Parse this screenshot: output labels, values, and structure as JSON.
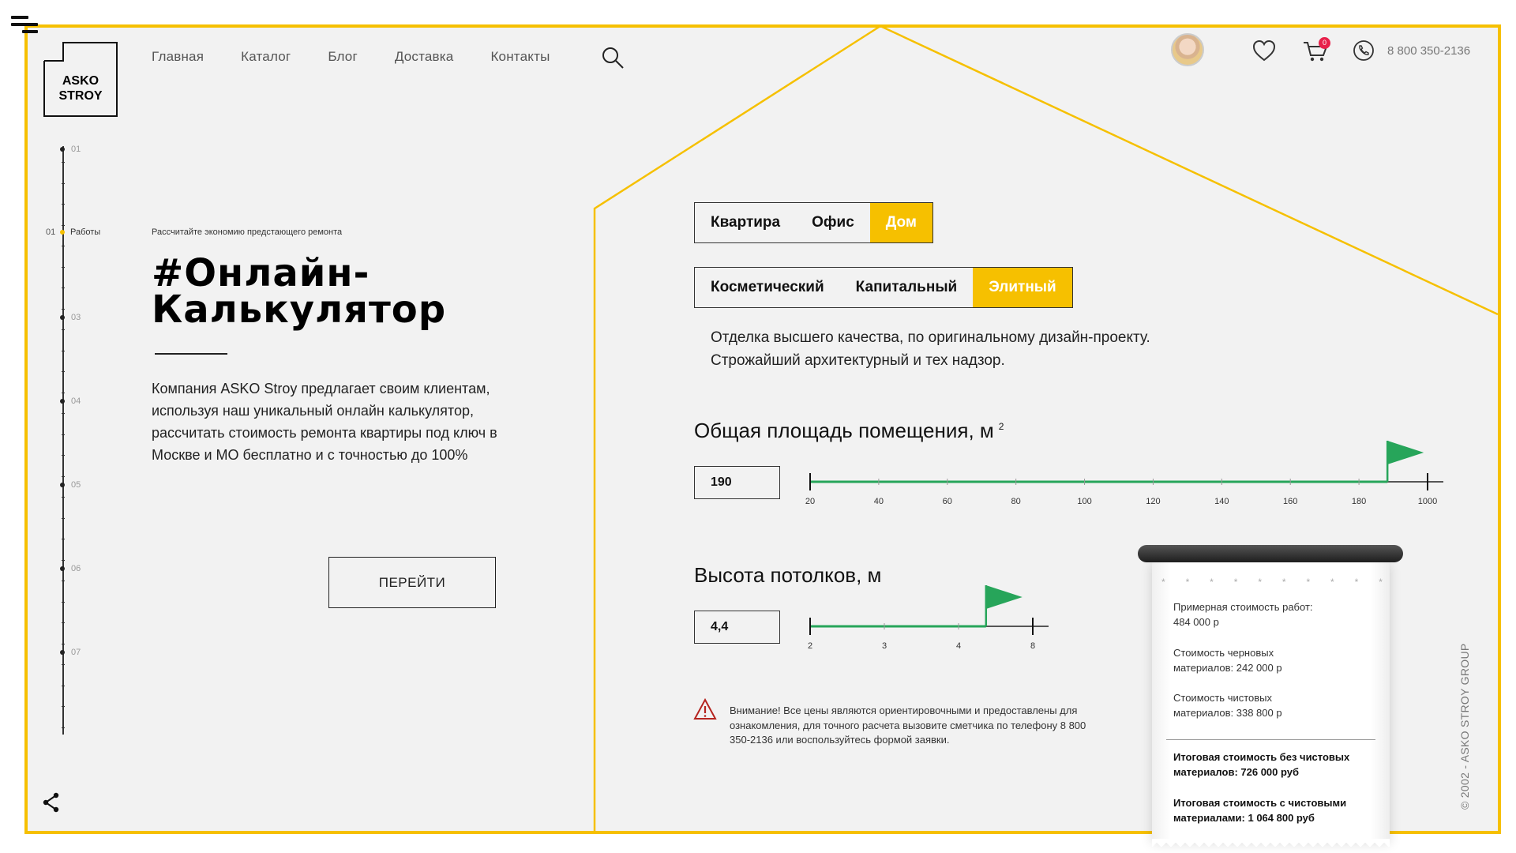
{
  "logo": {
    "line1": "ASKO",
    "line2": "STROY"
  },
  "nav": {
    "items": [
      "Главная",
      "Каталог",
      "Блог",
      "Доставка",
      "Контакты"
    ]
  },
  "header": {
    "cart_count": "0",
    "phone": "8 800 350-2136"
  },
  "steps": {
    "labels": [
      "01",
      "03",
      "04",
      "05",
      "06",
      "07"
    ],
    "active_num": "01",
    "active_label": "Работы"
  },
  "hero": {
    "subtitle": "Рассчитайте экономию предстающего ремонта",
    "title": "#Онлайн-Калькулятор",
    "description": "Компания ASKO Stroy предлагает своим клиентам, используя наш уникальный онлайн калькулятор, рассчитать стоимость ремонта квартиры под ключ в Москве и МО бесплатно и с точностью до 100%",
    "button": "ПЕРЕЙТИ"
  },
  "calc": {
    "types": [
      "Квартира",
      "Офис",
      "Дом"
    ],
    "type_selected": "Дом",
    "levels": [
      "Косметический",
      "Капитальный",
      "Элитный"
    ],
    "level_selected": "Элитный",
    "level_description": "Отделка  высшего качества, по оригинальному дизайн-проекту. Строжайший архитектурный и тех надзор.",
    "area": {
      "title": "Общая площадь помещения, м",
      "unit_sup": "2",
      "value": "190",
      "scale": [
        "20",
        "40",
        "60",
        "80",
        "100",
        "120",
        "140",
        "160",
        "180",
        "1000"
      ],
      "position": 0.935
    },
    "height": {
      "title": "Высота потолков, м",
      "value": "4,4",
      "scale": [
        "2",
        "3",
        "4",
        "8"
      ],
      "position": 0.79
    },
    "warning": "Внимание! Все цены являются ориентировочными и предоставлены для ознакомления, для точного расчета вызовите сметчика по телефону 8 800 350-2136 или воспользуйтесь формой заявки."
  },
  "receipt": {
    "stars": [
      "*",
      "*",
      "*",
      "*",
      "*",
      "*",
      "*",
      "*",
      "*",
      "*"
    ],
    "works_label": "Примерная стоимость работ:",
    "works_value": "484 000 р",
    "rough_label": "Стоимость черновых",
    "rough_value": "материалов: 242 000 р",
    "finish_label": "Стоимость чистовых",
    "finish_value": "материалов: 338 800 р",
    "total_without_1": "Итоговая стоимость без чистовых",
    "total_without_2": "материалов: 726 000 руб",
    "total_with_1": "Итоговая стоимость с чистовыми",
    "total_with_2": "материалами: 1 064 800 руб"
  },
  "footer": {
    "copyright": "© 2002 - ASKO STROY GROUP"
  },
  "colors": {
    "accent": "#f6c000",
    "slider": "#27a55a",
    "badge": "#e8214b",
    "warning": "#b5241f"
  }
}
